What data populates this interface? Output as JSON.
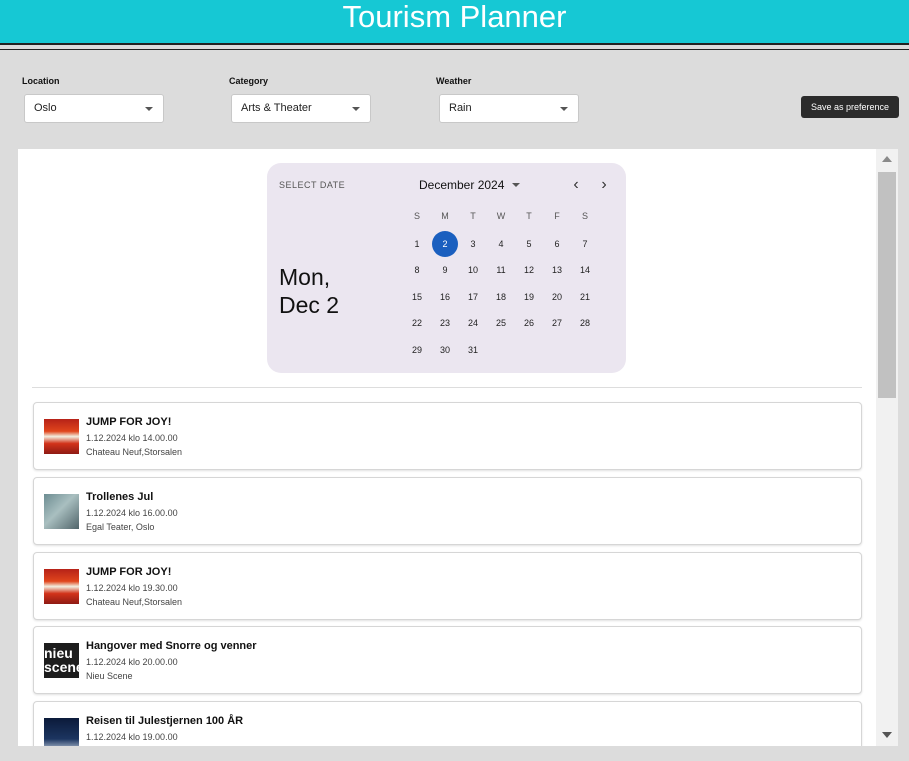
{
  "header": {
    "title": "Tourism Planner"
  },
  "filters": {
    "location": {
      "label": "Location",
      "value": "Oslo"
    },
    "category": {
      "label": "Category",
      "value": "Arts & Theater"
    },
    "weather": {
      "label": "Weather",
      "value": "Rain"
    }
  },
  "save_button": "Save as preference",
  "calendar": {
    "select_label": "SELECT DATE",
    "selected_line1": "Mon,",
    "selected_line2": "Dec 2",
    "month": "December 2024",
    "prev": "‹",
    "next": "›",
    "weekdays": [
      "S",
      "M",
      "T",
      "W",
      "T",
      "F",
      "S"
    ],
    "days": [
      "1",
      "2",
      "3",
      "4",
      "5",
      "6",
      "7",
      "8",
      "9",
      "10",
      "11",
      "12",
      "13",
      "14",
      "15",
      "16",
      "17",
      "18",
      "19",
      "20",
      "21",
      "22",
      "23",
      "24",
      "25",
      "26",
      "27",
      "28",
      "29",
      "30",
      "31"
    ],
    "selected_day": "2"
  },
  "events": [
    {
      "title": "JUMP FOR JOY!",
      "time": "1.12.2024 klo 14.00.00",
      "place": "Chateau Neuf,Storsalen",
      "thumb": "jump"
    },
    {
      "title": "Trollenes Jul",
      "time": "1.12.2024 klo 16.00.00",
      "place": "Egal Teater, Oslo",
      "thumb": "troll"
    },
    {
      "title": "JUMP FOR JOY!",
      "time": "1.12.2024 klo 19.30.00",
      "place": "Chateau Neuf,Storsalen",
      "thumb": "jump"
    },
    {
      "title": "Hangover med Snorre og venner",
      "time": "1.12.2024 klo 20.00.00",
      "place": "Nieu Scene",
      "thumb": "nieu"
    },
    {
      "title": "Reisen til Julestjernen 100 ÅR",
      "time": "1.12.2024 klo 19.00.00",
      "place": "",
      "thumb": "reisen"
    }
  ],
  "thumb_text": {
    "nieu": "nieu scene"
  }
}
